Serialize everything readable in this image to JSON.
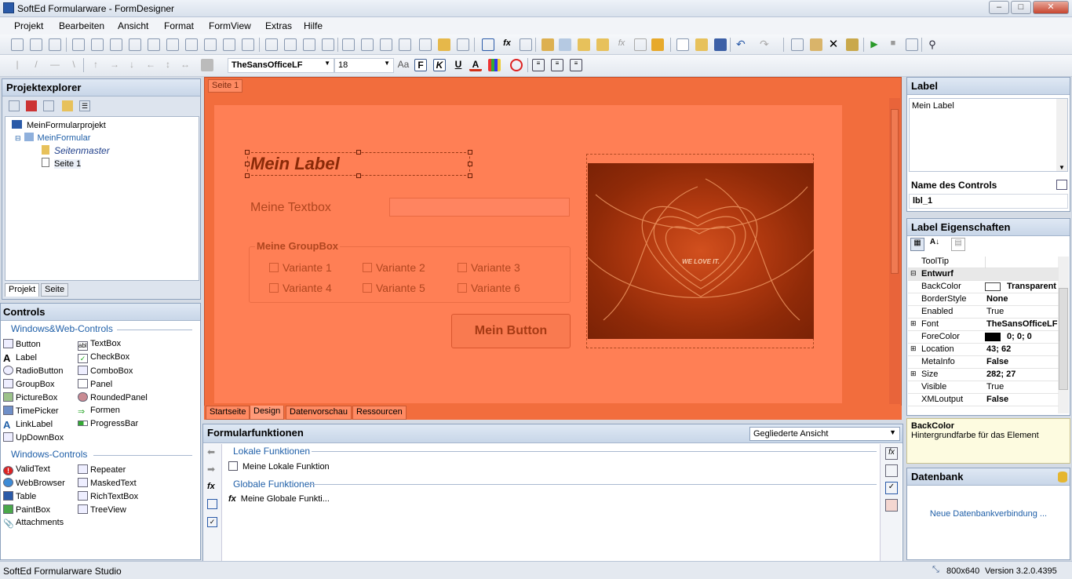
{
  "window": {
    "title": "SoftEd Formularware - FormDesigner"
  },
  "menu": [
    "Projekt",
    "Bearbeiten",
    "Ansicht",
    "Format",
    "FormView",
    "Extras",
    "Hilfe"
  ],
  "format_bar": {
    "font": "TheSansOfficeLF",
    "size": "18",
    "bold_label": "F",
    "italic_label": "K",
    "underline_label": "U"
  },
  "project_explorer": {
    "title": "Projektexplorer",
    "tree": [
      "MeinFormularprojekt",
      "MeinFormular",
      "Seitenmaster",
      "Seite 1"
    ],
    "tabs": [
      "Projekt",
      "Seite"
    ]
  },
  "controls": {
    "title": "Controls",
    "section1": "Windows&Web-Controls",
    "web_left": [
      "Button",
      "Label",
      "RadioButton",
      "GroupBox",
      "PictureBox",
      "TimePicker",
      "LinkLabel",
      "UpDownBox"
    ],
    "web_right": [
      "TextBox",
      "CheckBox",
      "ComboBox",
      "Panel",
      "RoundedPanel",
      "Formen",
      "ProgressBar"
    ],
    "section2": "Windows-Controls",
    "win_left": [
      "ValidText",
      "WebBrowser",
      "Table",
      "PaintBox",
      "Attachments"
    ],
    "win_right": [
      "Repeater",
      "MaskedText",
      "RichTextBox",
      "TreeView"
    ]
  },
  "designer": {
    "page_tab": "Seite 1",
    "label": "Mein Label",
    "textbox_label": "Meine Textbox",
    "groupbox_title": "Meine GroupBox",
    "variants": [
      "Variante 1",
      "Variante 2",
      "Variante 3",
      "Variante 4",
      "Variante 5",
      "Variante 6"
    ],
    "button": "Mein Button",
    "image_text": "WE LOVE IT.",
    "bottom_tabs": [
      "Startseite",
      "Design",
      "Datenvorschau",
      "Ressourcen"
    ]
  },
  "functions": {
    "title": "Formularfunktionen",
    "view": "Gegliederte Ansicht",
    "local_section": "Lokale Funktionen",
    "local_item": "Meine Lokale Funktion",
    "global_section": "Globale Funktionen",
    "global_item": "Meine Globale Funkti..."
  },
  "label_panel": {
    "title": "Label",
    "text": "Mein Label",
    "name_header": "Name des Controls",
    "name_value": "lbl_1"
  },
  "properties": {
    "title": "Label Eigenschaften",
    "rows": [
      {
        "name": "ToolTip",
        "value": ""
      },
      {
        "name": "Entwurf",
        "value": ""
      },
      {
        "name": "BackColor",
        "value": "Transparent"
      },
      {
        "name": "BorderStyle",
        "value": "None"
      },
      {
        "name": "Enabled",
        "value": "True"
      },
      {
        "name": "Font",
        "value": "TheSansOfficeLF"
      },
      {
        "name": "ForeColor",
        "value": "0; 0; 0"
      },
      {
        "name": "Location",
        "value": "43; 62"
      },
      {
        "name": "MetaInfo",
        "value": "False"
      },
      {
        "name": "Size",
        "value": "282; 27"
      },
      {
        "name": "Visible",
        "value": "True"
      },
      {
        "name": "XMLoutput",
        "value": "False"
      }
    ],
    "help_title": "BackColor",
    "help_text": "Hintergrundfarbe für das Element"
  },
  "database": {
    "title": "Datenbank",
    "link": "Neue Datenbankverbindung ..."
  },
  "status": {
    "left": "SoftEd Formularware Studio",
    "size": "800x640",
    "version": "Version 3.2.0.4395"
  },
  "colors": {
    "canvas": "#f26d3d",
    "design": "#ff7f55",
    "accent": "#1f5fa8"
  }
}
